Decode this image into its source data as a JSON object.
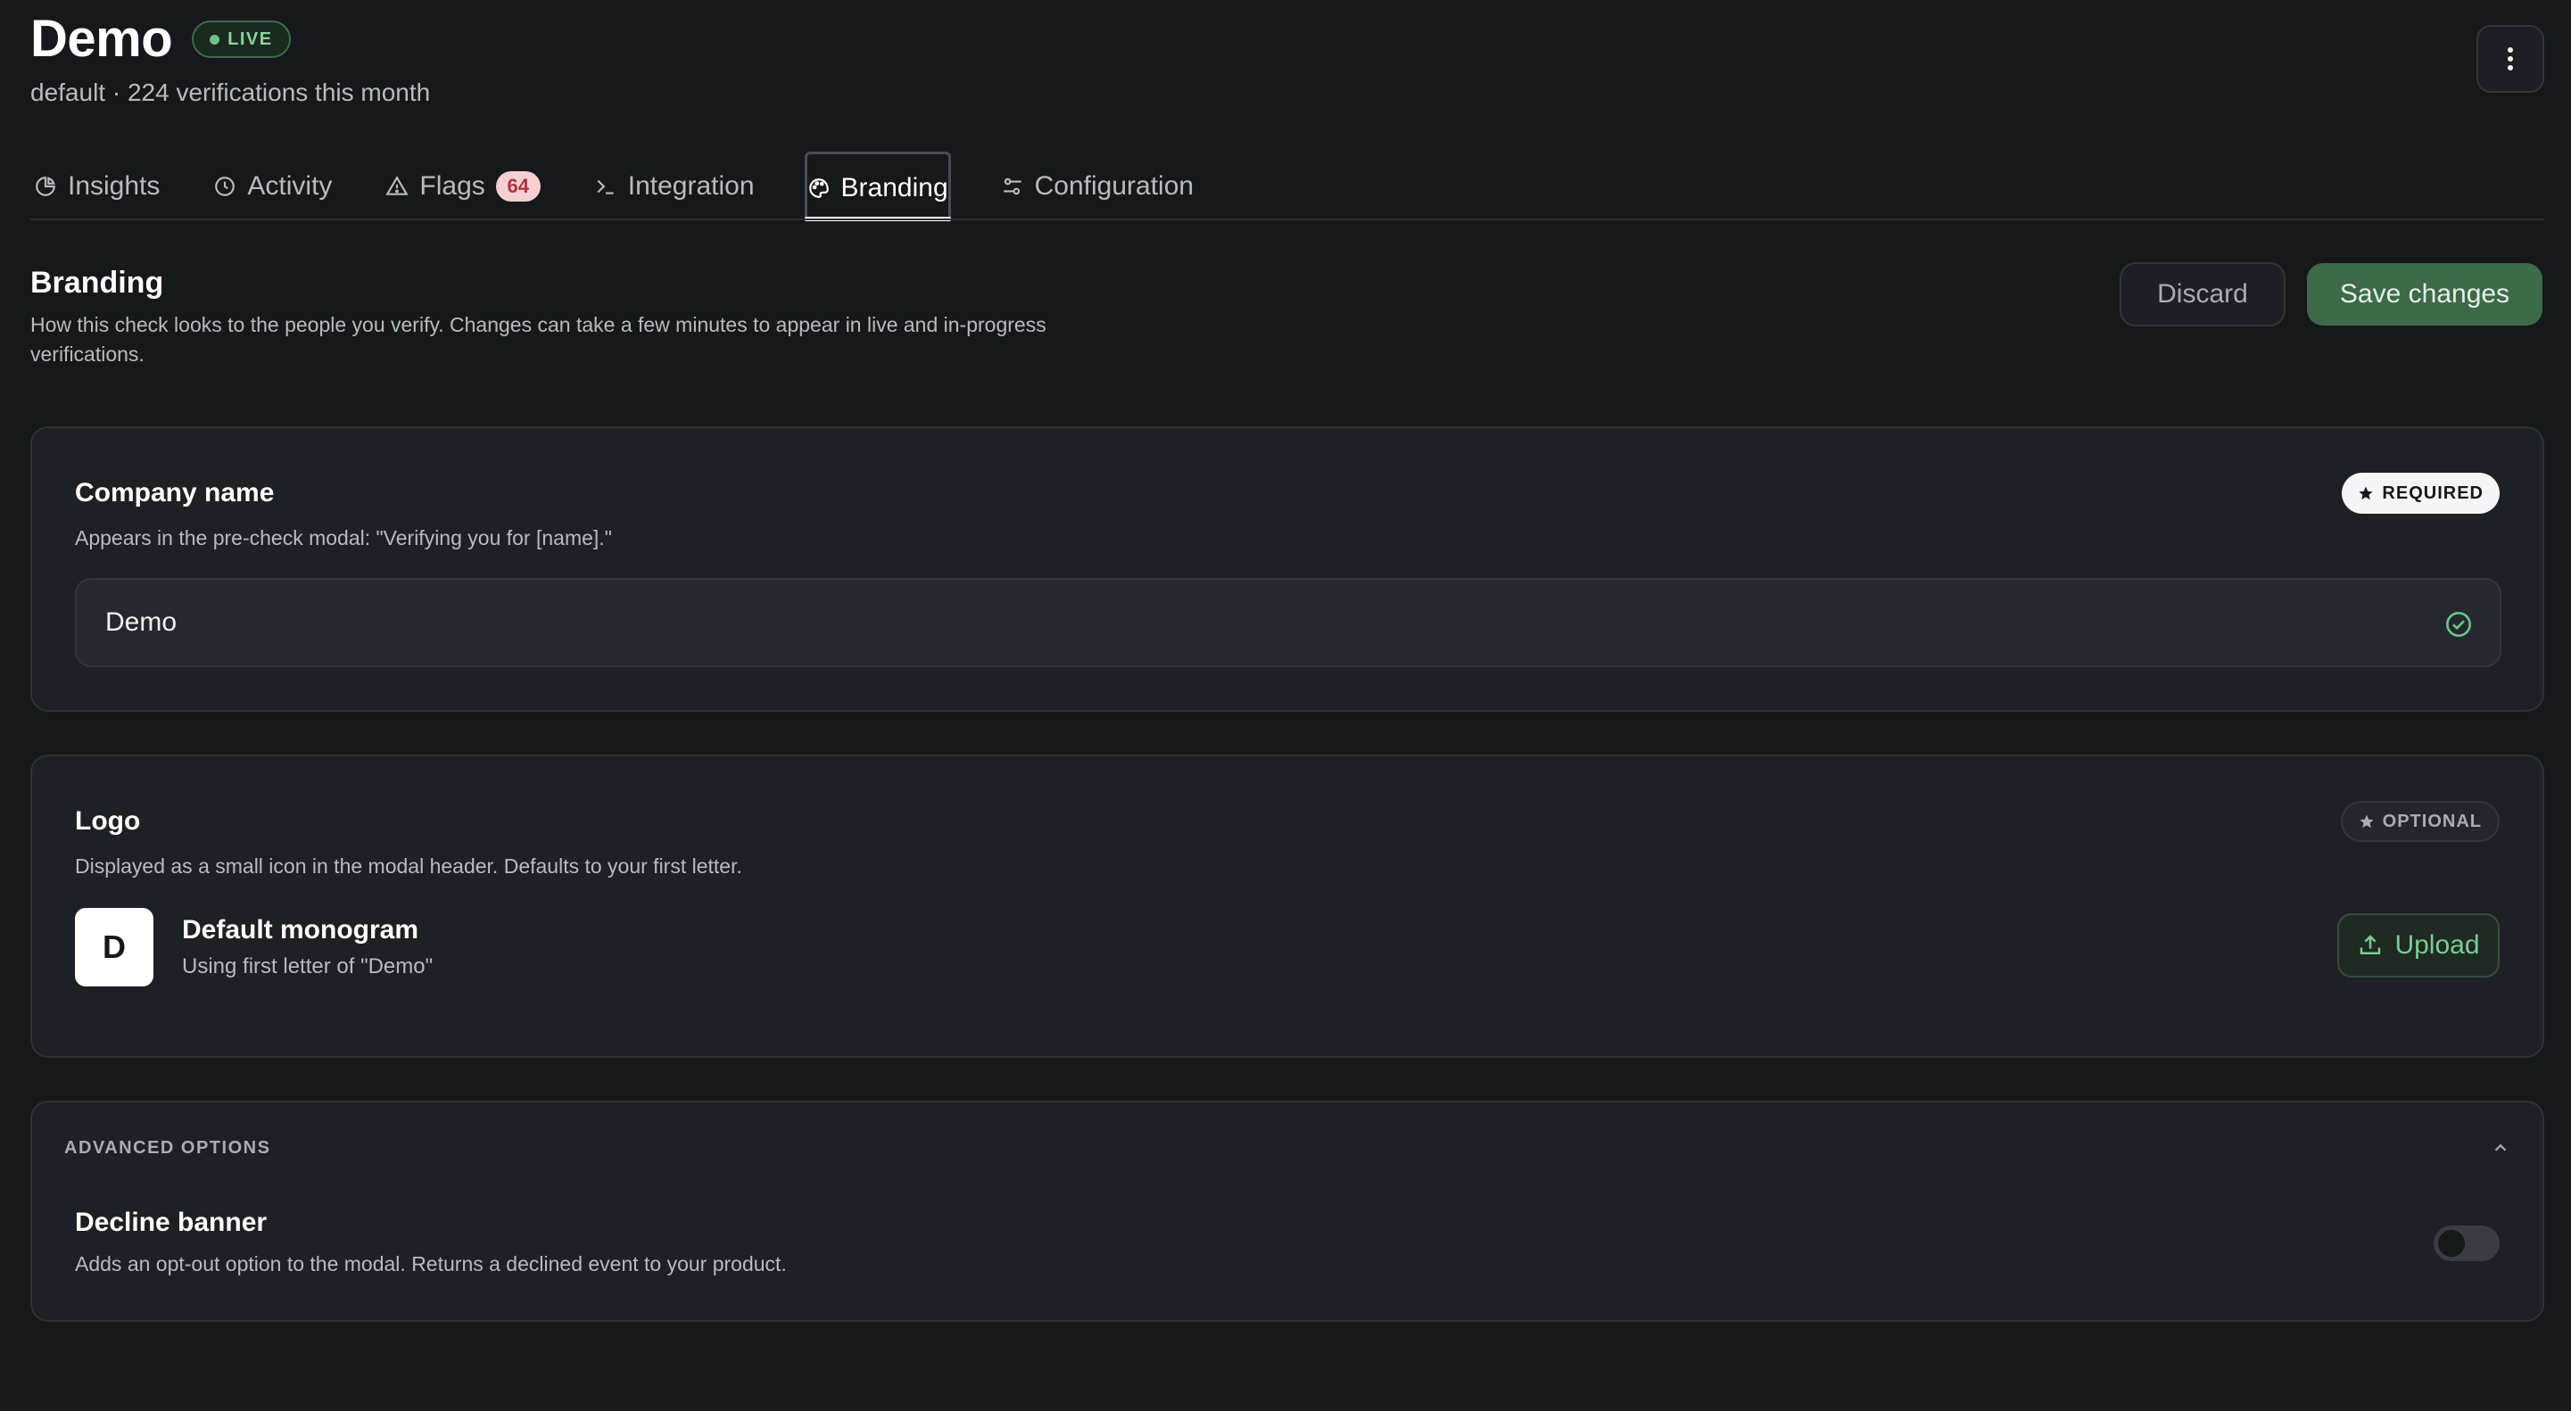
{
  "header": {
    "title": "Demo",
    "status_badge": "LIVE",
    "subtitle": "default · 224 verifications this month",
    "more_icon": "vertical-dots-icon"
  },
  "tabs": [
    {
      "label": "Insights",
      "icon": "pie-chart-icon"
    },
    {
      "label": "Activity",
      "icon": "clock-icon"
    },
    {
      "label": "Flags",
      "icon": "warning-triangle-icon",
      "count": "64"
    },
    {
      "label": "Integration",
      "icon": "terminal-icon"
    },
    {
      "label": "Branding",
      "icon": "palette-icon",
      "active": true
    },
    {
      "label": "Configuration",
      "icon": "sliders-icon"
    }
  ],
  "section": {
    "title": "Branding",
    "description": "How this check looks to the people you verify. Changes can take a few minutes to appear in live and in-progress verifications.",
    "discard_label": "Discard",
    "save_label": "Save changes"
  },
  "company_name": {
    "title": "Company name",
    "badge": "REQUIRED",
    "description": "Appears in the pre-check modal: \"Verifying you for [name].\"",
    "value": "Demo"
  },
  "logo": {
    "title": "Logo",
    "badge": "OPTIONAL",
    "description": "Displayed as a small icon in the modal header. Defaults to your first letter.",
    "monogram_letter": "D",
    "monogram_title": "Default monogram",
    "monogram_subtitle": "Using first letter of \"Demo\"",
    "upload_label": "Upload"
  },
  "advanced": {
    "label": "ADVANCED OPTIONS",
    "decline_title": "Decline banner",
    "decline_description": "Adds an opt-out option to the modal. Returns a declined event to your product.",
    "decline_enabled": false
  },
  "colors": {
    "background": "#17181c",
    "card": "#1e2025",
    "accent_green": "#3e6a4a",
    "live_green": "#6cc487",
    "flag_badge": "#f5d0d3"
  }
}
